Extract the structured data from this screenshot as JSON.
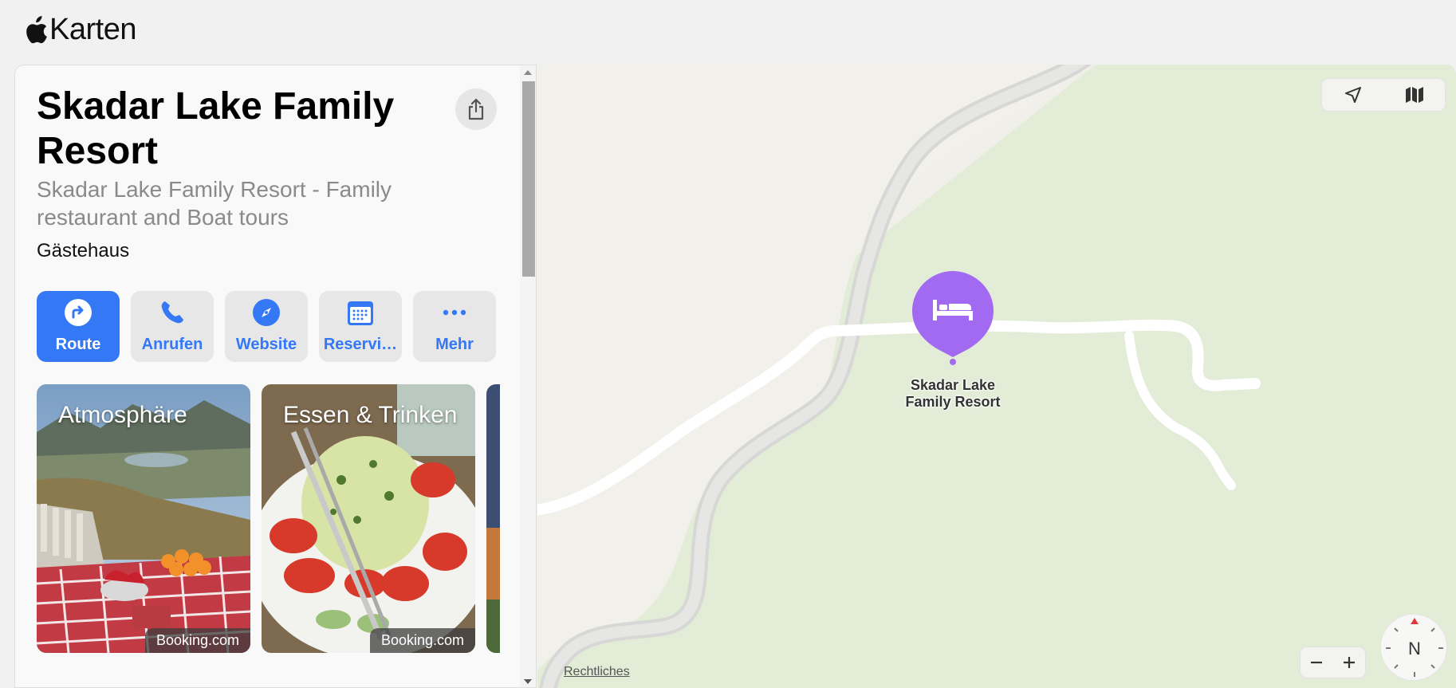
{
  "app": {
    "title": "Karten"
  },
  "place": {
    "name": "Skadar Lake Family Resort",
    "subtitle": "Skadar Lake Family Resort - Family restaurant and Boat tours",
    "category": "Gästehaus"
  },
  "actions": [
    {
      "label": "Route",
      "icon": "route-icon"
    },
    {
      "label": "Anrufen",
      "icon": "phone-icon"
    },
    {
      "label": "Website",
      "icon": "compass-icon"
    },
    {
      "label": "Reservi…",
      "icon": "calendar-icon"
    },
    {
      "label": "Mehr",
      "icon": "more-icon"
    }
  ],
  "photos": [
    {
      "title": "Atmosphäre",
      "source": "Booking.com"
    },
    {
      "title": "Essen & Trinken",
      "source": "Booking.com"
    }
  ],
  "map": {
    "pin_label": "Skadar Lake Family Resort",
    "pin_icon": "bed-icon",
    "legal_link": "Rechtliches",
    "compass_label": "N",
    "zoom_out": "−",
    "zoom_in": "+"
  },
  "colors": {
    "accent": "#3478f6",
    "pin": "#a26af0",
    "land": "#e2ecd6"
  }
}
